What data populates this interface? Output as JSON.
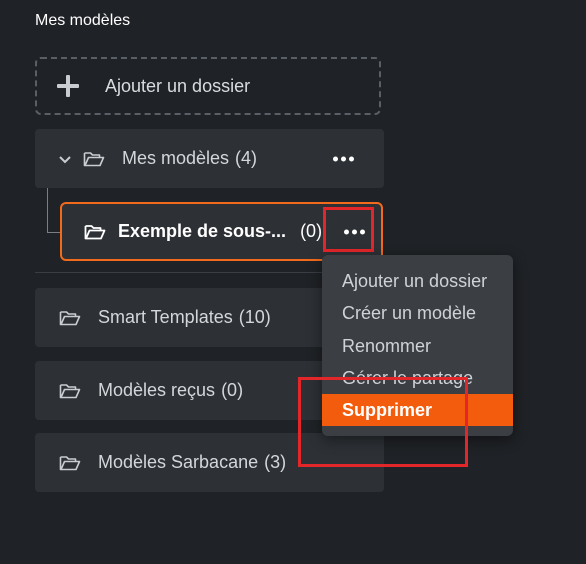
{
  "panel": {
    "title": "Mes modèles"
  },
  "add_folder": {
    "label": "Ajouter un dossier"
  },
  "main_folder": {
    "label": "Mes modèles",
    "count": "(4)"
  },
  "sub_folder": {
    "label": "Exemple de sous-...",
    "count": "(0)"
  },
  "folders": [
    {
      "label": "Smart Templates",
      "count": "(10)"
    },
    {
      "label": "Modèles reçus",
      "count": "(0)"
    },
    {
      "label": "Modèles Sarbacane",
      "count": "(3)"
    }
  ],
  "context_menu": {
    "items": [
      {
        "label": "Ajouter un dossier"
      },
      {
        "label": "Créer un modèle"
      },
      {
        "label": "Renommer"
      },
      {
        "label": "Gérer le partage"
      },
      {
        "label": "Supprimer"
      }
    ]
  },
  "colors": {
    "background": "#1f2226",
    "row": "#2d3136",
    "accent": "#f26a1b",
    "highlight": "#e3262a"
  }
}
